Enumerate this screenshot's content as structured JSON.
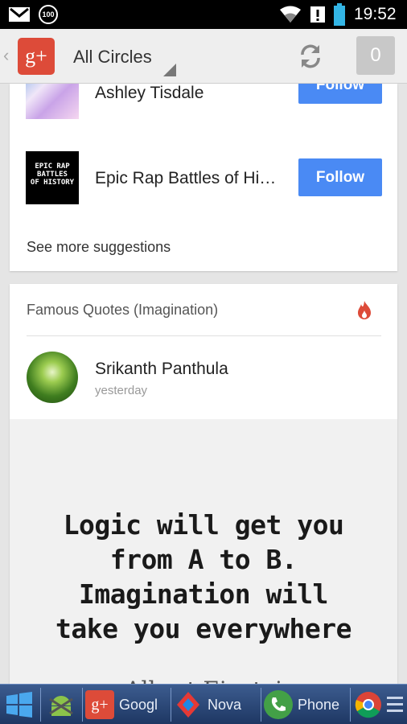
{
  "statusbar": {
    "battery_indicator": "100",
    "time": "19:52"
  },
  "actionbar": {
    "back_icon": "‹",
    "logo_text": "g+",
    "stream_selector": "All Circles",
    "notification_count": "0"
  },
  "suggestions": {
    "items": [
      {
        "name": "Ashley Tisdale",
        "button": "Follow"
      },
      {
        "name": "Epic Rap Battles of Hi…",
        "button": "Follow",
        "avatar_text": [
          "EPIC RAP",
          "BATTLES",
          "OF HISTORY"
        ]
      }
    ],
    "see_more": "See more suggestions"
  },
  "post": {
    "community": "Famous Quotes (Imagination)",
    "author": "Srikanth Panthula",
    "time": "yesterday",
    "quote_lines": [
      "Logic will get you",
      "from A to B.",
      "Imagination will",
      "take you everywhere"
    ],
    "quote_author": "- Albert Einstein"
  },
  "taskbar": {
    "items": [
      {
        "label": "Googl"
      },
      {
        "label": "Nova"
      },
      {
        "label": "Phone"
      }
    ]
  },
  "colors": {
    "follow_button": "#4a8af4",
    "gplus_red": "#dd4b39",
    "hot_icon": "#dd4b39",
    "taskbar": "#2a4778"
  },
  "icons": [
    "gmail-icon",
    "battery-100-icon",
    "wifi-icon",
    "alert-icon",
    "battery-icon",
    "refresh-icon",
    "hot-icon",
    "windows-start-icon",
    "android-icon",
    "chrome-icon",
    "menu-icon"
  ]
}
